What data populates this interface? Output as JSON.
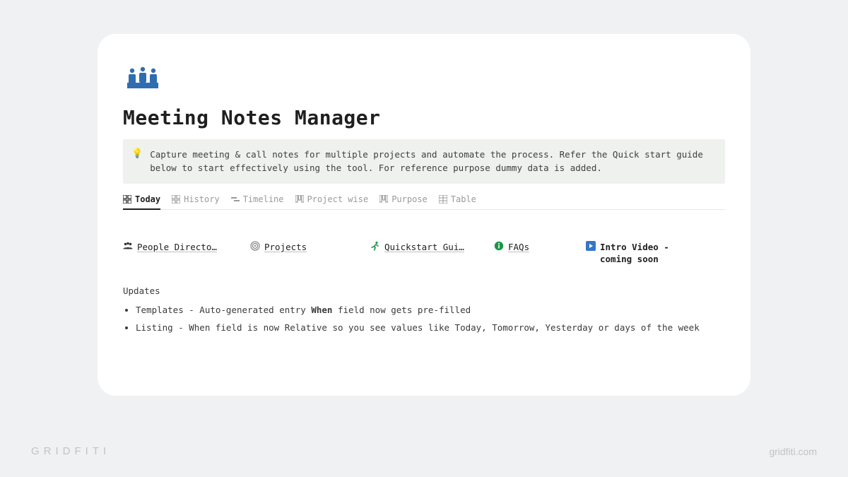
{
  "page": {
    "title": "Meeting Notes Manager"
  },
  "callout": {
    "icon": "💡",
    "text": "Capture meeting & call notes for multiple projects and automate the process. Refer the Quick start guide below to start effectively using the tool. For reference purpose dummy data is added."
  },
  "tabs": [
    {
      "icon": "gallery",
      "label": "Today",
      "active": true
    },
    {
      "icon": "gallery",
      "label": "History",
      "active": false
    },
    {
      "icon": "timeline",
      "label": "Timeline",
      "active": false
    },
    {
      "icon": "board",
      "label": "Project wise",
      "active": false
    },
    {
      "icon": "board",
      "label": "Purpose",
      "active": false
    },
    {
      "icon": "table",
      "label": "Table",
      "active": false
    }
  ],
  "links": [
    {
      "icon": "people",
      "label": "People Directo…"
    },
    {
      "icon": "target",
      "label": "Projects"
    },
    {
      "icon": "runner",
      "label": "Quickstart Gui…"
    },
    {
      "icon": "info",
      "label": "FAQs"
    },
    {
      "icon": "play",
      "label": "Intro Video - coming soon"
    }
  ],
  "updates": {
    "heading": "Updates",
    "items": [
      {
        "prefix": "Templates - Auto-generated entry ",
        "bold": "When",
        "suffix": " field now gets pre-filled"
      },
      {
        "prefix": "Listing - When field is now Relative so you see values like Today, Tomorrow, Yesterday or days of the week",
        "bold": "",
        "suffix": ""
      }
    ]
  },
  "footer": {
    "left": "GRIDFITI",
    "right": "gridfiti.com"
  }
}
